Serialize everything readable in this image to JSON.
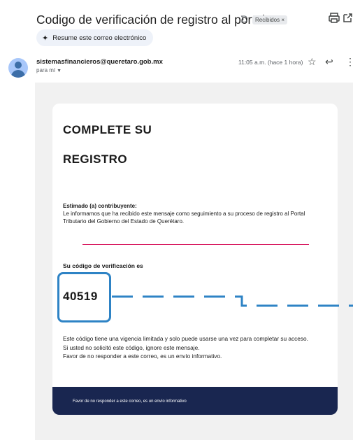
{
  "email": {
    "subject": "Codigo de verificación de registro al portal",
    "label": "Recibidos ×",
    "summary_button": "Resume este correo electrónico",
    "sender": "sistemasfinancieros@queretaro.gob.mx",
    "recipient": "para mí",
    "timestamp": "11:05 a.m. (hace 1 hora)"
  },
  "body": {
    "heading_line1": "COMPLETE SU",
    "heading_line2": "REGISTRO",
    "greeting": "Estimado (a) contribuyente:",
    "intro": "Le informamos que ha recibido este mensaje como seguimiento a su proceso de registro al Portal Tributario del Gobierno del Estado de Querétaro.",
    "code_label": "Su código de verificación es",
    "code": "40519",
    "footer_line1": "Este código tiene una vigencia limitada y solo puede usarse una vez para completar su acceso.",
    "footer_line2": "Si usted no solicitó este código, ignore este mensaje.",
    "footer_line3": "Favor de no responder a este correo, es un envío informativo.",
    "footer_bar": "Favor de no responder a este correo, es un envío informativo"
  },
  "icons": {
    "importance": "importance-icon",
    "print": "print-icon",
    "open_new_window": "open-in-new-window-icon",
    "sparkle": "sparkle-icon",
    "star": "star-icon",
    "reply": "reply-icon",
    "more": "more-vert-icon"
  },
  "colors": {
    "accent_pink": "#d81b60",
    "code_highlight": "#2e83c5",
    "footer_navy": "#192650"
  }
}
